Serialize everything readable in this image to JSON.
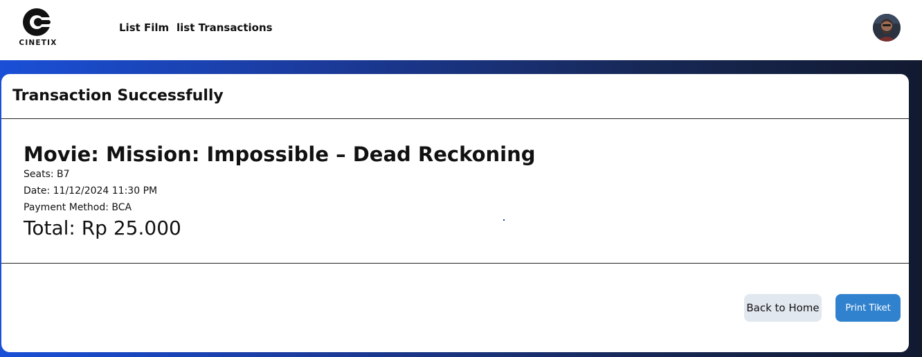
{
  "brand": {
    "name": "CINETIX",
    "logo_icon": "cinetix-logo-icon"
  },
  "nav": {
    "links": [
      {
        "label": "List Film"
      },
      {
        "label": "list Transactions"
      }
    ],
    "avatar_icon": "user-avatar"
  },
  "colors": {
    "band_gradient": [
      "#1a4fd6",
      "#1b3a9a",
      "#172856",
      "#121a30"
    ],
    "primary_button": "#3182ce",
    "secondary_button": "#e2e8f0"
  },
  "card": {
    "title": "Transaction Successfully",
    "movie": "Movie: Mission: Impossible – Dead Reckoning",
    "seats": "Seats: B7",
    "date": "Date: 11/12/2024 11:30 PM",
    "payment": "Payment Method: BCA",
    "total": "Total: Rp 25.000"
  },
  "actions": {
    "back_label": "Back to Home",
    "print_label": "Print Tiket"
  }
}
